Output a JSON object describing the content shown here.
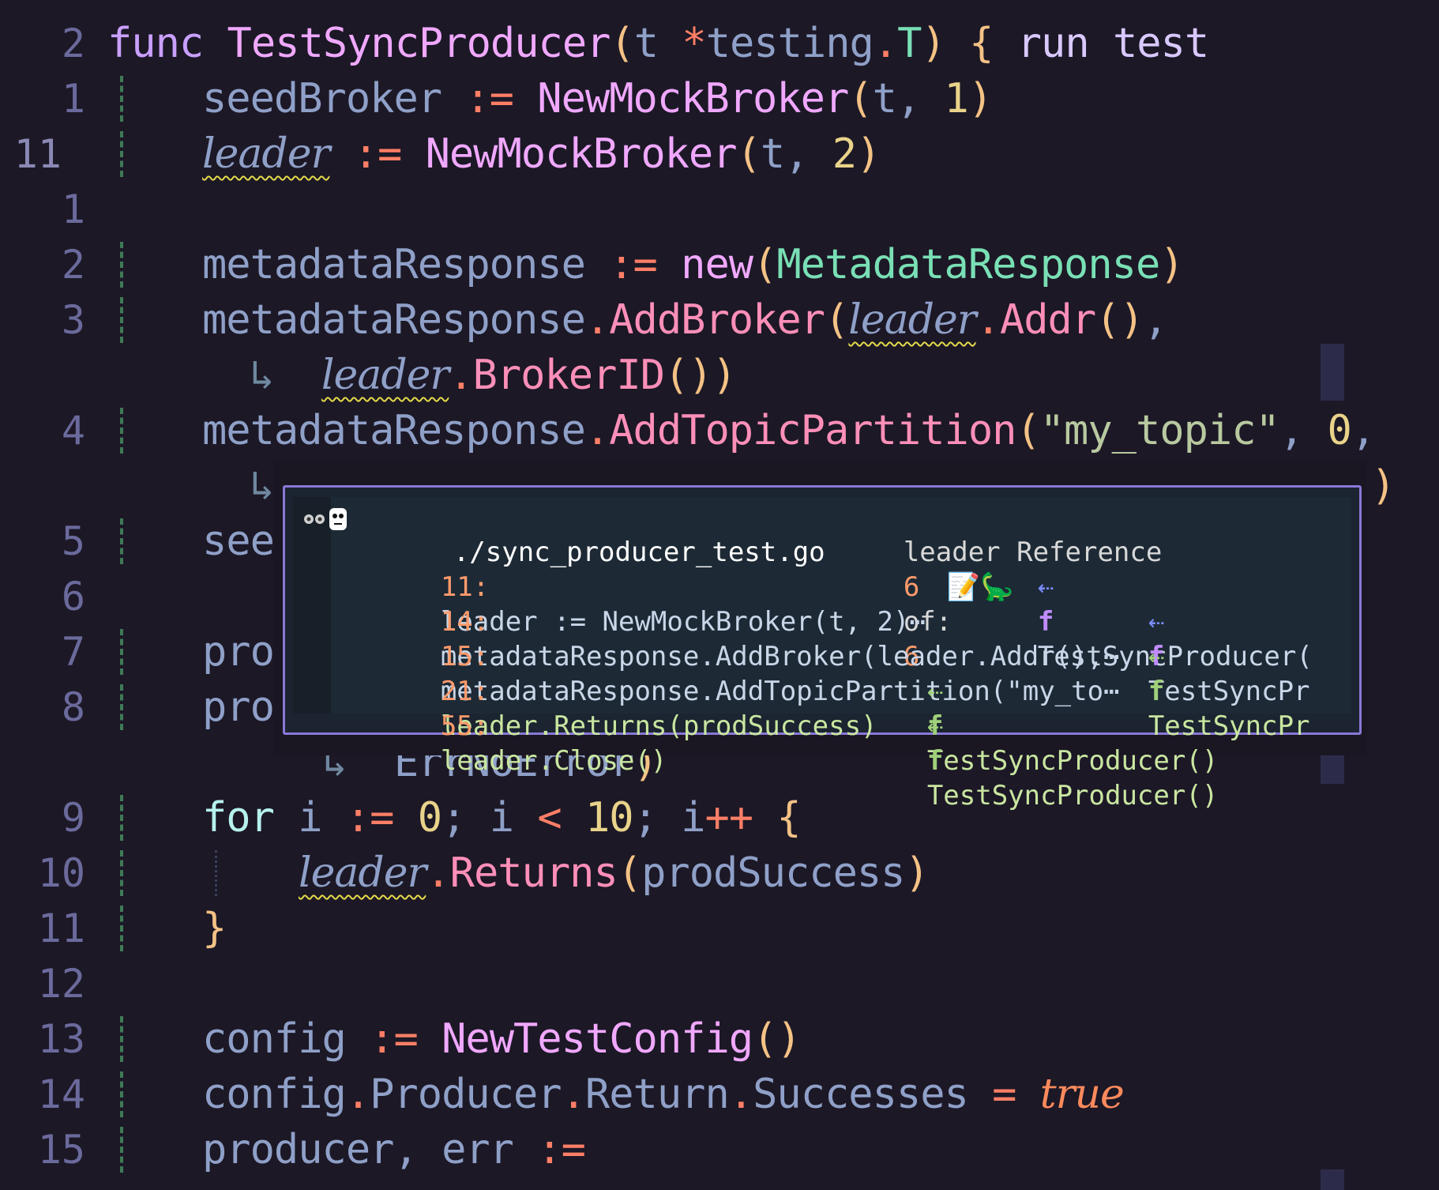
{
  "editor": {
    "lines": [
      {
        "num": "2",
        "tokens": [
          [
            "kw",
            "func "
          ],
          [
            "fn",
            "TestSyncProducer"
          ],
          [
            "paren",
            "("
          ],
          [
            "id",
            "t "
          ],
          [
            "op",
            "*"
          ],
          [
            "id",
            "testing"
          ],
          [
            "op",
            "."
          ],
          [
            "typ",
            "T"
          ],
          [
            "paren",
            ")"
          ],
          [
            "id",
            " "
          ],
          [
            "brace",
            "{"
          ],
          [
            "hint",
            " run test"
          ]
        ]
      },
      {
        "num": "1",
        "tokens": [
          [
            "id",
            "seedBroker "
          ],
          [
            "op",
            ":= "
          ],
          [
            "fn",
            "NewMockBroker"
          ],
          [
            "paren",
            "("
          ],
          [
            "id",
            "t, "
          ],
          [
            "num",
            "1"
          ],
          [
            "paren",
            ")"
          ]
        ]
      },
      {
        "num": "11",
        "tokens": [
          [
            "ital",
            "leader"
          ],
          [
            "id",
            " "
          ],
          [
            "op",
            ":= "
          ],
          [
            "fn",
            "NewMockBroker"
          ],
          [
            "paren",
            "("
          ],
          [
            "id",
            "t, "
          ],
          [
            "num",
            "2"
          ],
          [
            "paren",
            ")"
          ]
        ]
      },
      {
        "num": "1",
        "tokens": []
      },
      {
        "num": "2",
        "tokens": [
          [
            "id",
            "metadataResponse "
          ],
          [
            "op",
            ":= "
          ],
          [
            "fn",
            "new"
          ],
          [
            "paren",
            "("
          ],
          [
            "typ",
            "MetadataResponse"
          ],
          [
            "paren",
            ")"
          ]
        ]
      },
      {
        "num": "3",
        "tokens": [
          [
            "id",
            "metadataResponse"
          ],
          [
            "op",
            "."
          ],
          [
            "fnp",
            "AddBroker"
          ],
          [
            "paren",
            "("
          ],
          [
            "ital",
            "leader"
          ],
          [
            "op",
            "."
          ],
          [
            "fnp",
            "Addr"
          ],
          [
            "paren",
            "()"
          ],
          [
            "id",
            ","
          ]
        ]
      },
      {
        "num": "",
        "tokens": [
          [
            "arrow",
            "↳  "
          ],
          [
            "ital",
            "leader"
          ],
          [
            "op",
            "."
          ],
          [
            "fnp",
            "BrokerID"
          ],
          [
            "paren",
            "()"
          ],
          [
            "paren",
            ")"
          ]
        ]
      },
      {
        "num": "4",
        "tokens": [
          [
            "id",
            "metadataResponse"
          ],
          [
            "op",
            "."
          ],
          [
            "fnp",
            "AddTopicPartition"
          ],
          [
            "paren",
            "("
          ],
          [
            "str",
            "\"my_topic\""
          ],
          [
            "id",
            ", "
          ],
          [
            "num",
            "0"
          ],
          [
            "id",
            ","
          ]
        ]
      },
      {
        "num": "",
        "tokens": [
          [
            "arrow",
            "↳"
          ]
        ]
      },
      {
        "num": "5",
        "tokens": [
          [
            "id",
            "see"
          ]
        ]
      },
      {
        "num": "6",
        "tokens": []
      },
      {
        "num": "7",
        "tokens": [
          [
            "id",
            "pro"
          ]
        ]
      },
      {
        "num": "8",
        "tokens": [
          [
            "id",
            "pro"
          ]
        ]
      },
      {
        "num": "",
        "tokens": [
          [
            "arrow",
            "↳  "
          ],
          [
            "id",
            "ErrNoError"
          ],
          [
            "paren",
            ")"
          ]
        ]
      },
      {
        "num": "9",
        "tokens": [
          [
            "kwfor",
            "for "
          ],
          [
            "id",
            "i "
          ],
          [
            "op",
            ":= "
          ],
          [
            "num",
            "0"
          ],
          [
            "id",
            "; i "
          ],
          [
            "op",
            "< "
          ],
          [
            "num",
            "10"
          ],
          [
            "id",
            "; i"
          ],
          [
            "op",
            "++ "
          ],
          [
            "brace",
            "{"
          ]
        ]
      },
      {
        "num": "10",
        "tokens": [
          [
            "ital",
            "leader"
          ],
          [
            "op",
            "."
          ],
          [
            "fnp",
            "Returns"
          ],
          [
            "paren",
            "("
          ],
          [
            "id",
            "prodSuccess"
          ],
          [
            "paren",
            ")"
          ]
        ]
      },
      {
        "num": "11",
        "tokens": [
          [
            "brace",
            "}"
          ]
        ]
      },
      {
        "num": "12",
        "tokens": []
      },
      {
        "num": "13",
        "tokens": [
          [
            "id",
            "config "
          ],
          [
            "op",
            ":= "
          ],
          [
            "fn",
            "NewTestConfig"
          ],
          [
            "paren",
            "()"
          ]
        ]
      },
      {
        "num": "14",
        "tokens": [
          [
            "id",
            "config"
          ],
          [
            "op",
            "."
          ],
          [
            "id",
            "Producer"
          ],
          [
            "op",
            "."
          ],
          [
            "id",
            "Return"
          ],
          [
            "op",
            "."
          ],
          [
            "id",
            "Successes "
          ],
          [
            "op",
            "= "
          ],
          [
            "true",
            "true"
          ]
        ]
      },
      {
        "num": "15",
        "tokens": [
          [
            "id",
            "producer, err "
          ],
          [
            "op",
            ":="
          ]
        ]
      }
    ]
  },
  "popup": {
    "file": "./sync_producer_test.go",
    "ref_label": "leader Reference",
    "ref_index": "6",
    "ref_of": "of:",
    "ref_total": "6",
    "rows": [
      {
        "line": "11:",
        "code": "leader := NewMockBroker(t, 2)⋯",
        "func": "TestSyncProducer("
      },
      {
        "line": "14:",
        "code": "metadataResponse.AddBroker(leader.Addr(),⋯",
        "func": "TestSyncPr"
      },
      {
        "line": "15:",
        "code": "metadataResponse.AddTopicPartition(\"my_to⋯",
        "func": "TestSyncPr"
      },
      {
        "line": "21:",
        "code": "leader.Returns(prodSuccess)",
        "func": "TestSyncProducer()"
      },
      {
        "line": "55:",
        "code": "leader.Close()",
        "func": "TestSyncProducer()"
      }
    ],
    "icons": {
      "emoji": "📝🦕",
      "call": "⇠",
      "f": "f"
    }
  }
}
